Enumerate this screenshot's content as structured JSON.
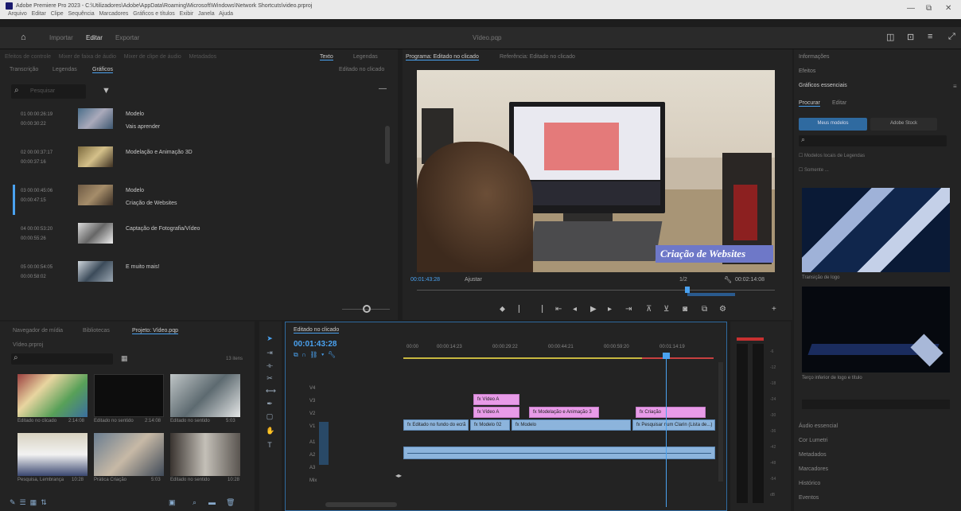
{
  "window": {
    "title": "Adobe Premiere Pro 2023 - C:\\Utilizadores\\Adobe\\AppData\\Roaming\\Microsoft\\Windows\\Network Shortcuts\\video.prproj",
    "menu": [
      "Arquivo",
      "Editar",
      "Clipe",
      "Sequência",
      "Marcadores",
      "Gráficos e títulos",
      "Exibir",
      "Janela",
      "Ajuda"
    ],
    "controls": [
      "—",
      "⧉",
      "✕"
    ]
  },
  "workspace": {
    "tabs": [
      "Importar",
      "Editar",
      "Exportar"
    ],
    "active": "Editar",
    "center_title": "Vídeo.pqp"
  },
  "markers_panel": {
    "tabs": [
      "Transcrição",
      "Legendas",
      "Gráficos"
    ],
    "active_tab": "Gráficos",
    "header_right": "Editado no clicado",
    "search_placeholder": "Pesquisar",
    "items": [
      {
        "tc1": "01 00:00:26:19",
        "tc2": "00:00:30:22",
        "name1": "Modelo",
        "name2": "Vais aprender"
      },
      {
        "tc1": "02 00:00:37:17",
        "tc2": "00:00:37:16",
        "name1": "Modelação e Animação 3D",
        "name2": ""
      },
      {
        "tc1": "03 00:00:45:06",
        "tc2": "00:00:47:15",
        "name1": "Modelo",
        "name2": "Criação de Websites"
      },
      {
        "tc1": "04 00:00:53:20",
        "tc2": "00:00:55:26",
        "name1": "Captação de Fotografia/Vídeo",
        "name2": ""
      },
      {
        "tc1": "05 00:00:54:05",
        "tc2": "00:00:58:02",
        "name1": "E muito mais!",
        "name2": ""
      }
    ]
  },
  "program_monitor": {
    "tab": "Programa: Editado no clicado",
    "tab2": "Referência: Editado no clicado",
    "timecode_left": "00:01:43:28",
    "fit": "Ajustar",
    "timecode_right": "00:02:14:08",
    "overlay_text": "Criação de Websites",
    "zoom": "1/2"
  },
  "project_panel": {
    "tabs": [
      "Navegador de mídia",
      "Bibliotecas",
      "Projeto: Vídeo.pqp"
    ],
    "active_tab": "Projeto: Vídeo.pqp",
    "path": "Vídeo.prproj",
    "items_count": "13 itens",
    "thumbs": [
      {
        "label": "Editado no clicado",
        "dur": "2:14:08"
      },
      {
        "label": "Editado no sentido",
        "dur": "2:14:08"
      },
      {
        "label": "Editado no sentido",
        "dur": "5:03"
      },
      {
        "label": "Pesquisa, Lembrança",
        "dur": "10:28"
      },
      {
        "label": "Prática Criação",
        "dur": "5:03"
      },
      {
        "label": "Editado no sentido",
        "dur": "10:28"
      }
    ]
  },
  "timeline": {
    "tab": "Editado no clicado",
    "timecode": "00:01:43:28",
    "ruler": [
      "00:00",
      "00:00:14:23",
      "00:00:29:22",
      "00:00:44:21",
      "00:00:59:20",
      "00:01:14:19"
    ],
    "tracks": [
      "V4",
      "V3",
      "V2",
      "V1",
      "A1",
      "A2",
      "A3",
      "Mix"
    ],
    "clips_v3": [
      {
        "label": "fx Vídeo A"
      }
    ],
    "clips_v2": [
      {
        "label": "fx Vídeo A"
      },
      {
        "label": "fx Modelação e Animação 3"
      },
      {
        "label": "fx Criação"
      }
    ],
    "clips_v1": [
      {
        "label": "fx Editado no fundo do ecrã"
      },
      {
        "label": "fx Modelo 02"
      },
      {
        "label": "fx Modelo"
      },
      {
        "label": "fx Pesquisar num Clarin (Lista de...)"
      }
    ]
  },
  "essential_graphics": {
    "items_top": [
      "Informações",
      "Efeitos",
      "Gráficos essenciais"
    ],
    "tabs": [
      "Procurar",
      "Editar"
    ],
    "buttons": [
      "Meus modelos",
      "Adobe Stock"
    ],
    "checks": [
      "Modelos locais de Legendas",
      "Somente ..."
    ],
    "templates": [
      {
        "label": "Transição de logo"
      },
      {
        "label": "Terço inferior de logo e título"
      }
    ],
    "bottom": [
      "Áudio essencial",
      "Cor Lumetri",
      "Metadados",
      "Marcadores",
      "Histórico",
      "Eventos"
    ]
  }
}
